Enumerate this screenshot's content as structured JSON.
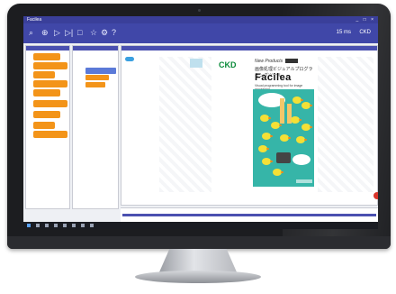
{
  "window": {
    "title": "Facilea",
    "controls": "_ □ ×"
  },
  "toolbar": {
    "icons": [
      "search-icon",
      "zoom-icon",
      "play-icon",
      "step-icon",
      "stop-icon",
      "star-icon",
      "settings-icon",
      "help-icon"
    ],
    "speed": "15 ms",
    "right_label": "CKD"
  },
  "poster": {
    "company": "CKD",
    "tagline": "New Products",
    "jp_title": "画像処理ビジュアルプログラミングツール",
    "brand": "Facilea",
    "subtitle": "Visual programming tool for image processing",
    "bubble": "誰でもカンタン 開発できます！"
  },
  "colors": {
    "accent": "#4047a8",
    "block": "#f39419",
    "poster_bg": "#36b5a8",
    "record": "#d9342b"
  },
  "taskbar": {
    "clock": ""
  }
}
